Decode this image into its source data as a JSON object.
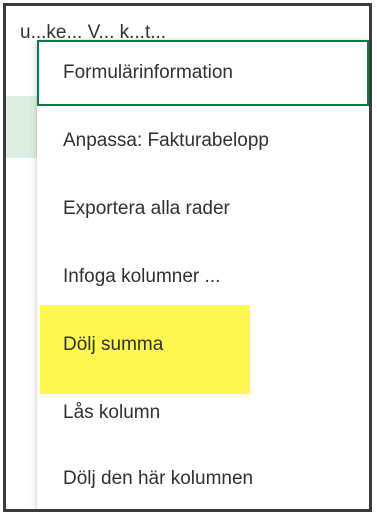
{
  "background": {
    "header_fragment": "u...ke... V... k...t...",
    "accent_color": "#107c41",
    "row_tint": "#dcefe0"
  },
  "menu": {
    "items": [
      {
        "label": "Formulärinformation",
        "focused": true
      },
      {
        "label": "Anpassa: Fakturabelopp",
        "focused": false
      },
      {
        "label": "Exportera alla rader",
        "focused": false
      },
      {
        "label": "Infoga kolumner ...",
        "focused": false
      },
      {
        "label": "Dölj summa",
        "focused": false,
        "highlighted": true
      },
      {
        "label": "Lås kolumn",
        "focused": false
      },
      {
        "label": "Dölj den här kolumnen",
        "focused": false
      }
    ],
    "highlight_color": "#fff74f"
  }
}
